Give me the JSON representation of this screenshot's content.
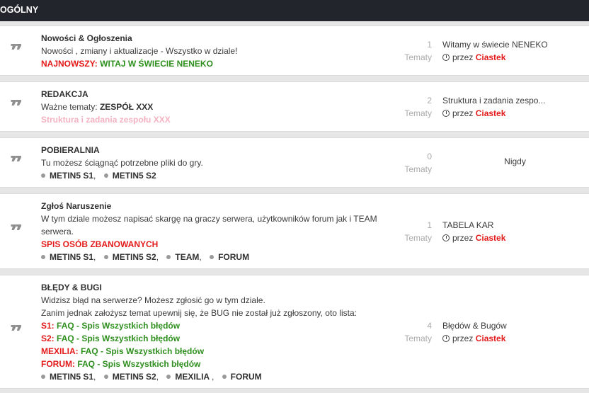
{
  "category": {
    "title": "OGÓLNY"
  },
  "labels": {
    "topics": "Tematy",
    "by": "przez",
    "never": "Nigdy"
  },
  "forums": [
    {
      "title": "Nowości & Ogłoszenia",
      "desc": "Nowości , zmiany i aktualizacje - Wszystko w dziale!",
      "newest_label": "NAJNOWSZY:",
      "newest_link": "WITAJ W ŚWIECIE NENEKO",
      "count": "1",
      "last_title": "Witamy w świecie NENEKO",
      "last_author": "Ciastek"
    },
    {
      "title": "REDAKCJA",
      "desc_label": "Ważne tematy:",
      "desc_bold": "ZESPÓŁ XXX",
      "link": "Struktura i zadania zespołu XXX",
      "count": "2",
      "last_title": "Struktura i zadania zespo...",
      "last_author": "Ciastek"
    },
    {
      "title": "POBIERALNIA",
      "desc": "Tu możesz ściągnąć potrzebne pliki do gry.",
      "subforums": [
        "METIN5 S1",
        "METIN5 S2"
      ],
      "count": "0"
    },
    {
      "title": "Zgłoś Naruszenie",
      "desc1": "W tym dziale możesz napisać skargę na graczy serwera, użytkowników forum jak i TEAM",
      "desc2": "serwera.",
      "link": "SPIS OSÓB ZBANOWANYCH",
      "subforums": [
        "METIN5 S1",
        "METIN5 S2",
        "TEAM",
        "FORUM"
      ],
      "count": "1",
      "last_title": "TABELA KAR",
      "last_author": "Ciastek"
    },
    {
      "title": "BŁĘDY & BUGI",
      "desc1": "Widzisz błąd na serwerze? Możesz zgłosić go w tym dziale.",
      "desc2": "Zanim jednak założysz temat upewnij się, że BUG nie został już zgłoszony, oto lista:",
      "lists": [
        {
          "prefix": "S1:",
          "text": "FAQ - Spis Wszystkich błędów"
        },
        {
          "prefix": "S2:",
          "text": "FAQ - Spis Wszystkich błędów"
        },
        {
          "prefix": "MEXILIA:",
          "text": "FAQ - Spis Wszystkich błędów"
        },
        {
          "prefix": "FORUM:",
          "text": "FAQ - Spis Wszystkich błędów"
        }
      ],
      "subforums": [
        "METIN5 S1",
        "METIN5 S2",
        "MEXILIA ",
        "FORUM"
      ],
      "count": "4",
      "last_title": "Błędów & Bugów",
      "last_author": "Ciastek"
    }
  ]
}
